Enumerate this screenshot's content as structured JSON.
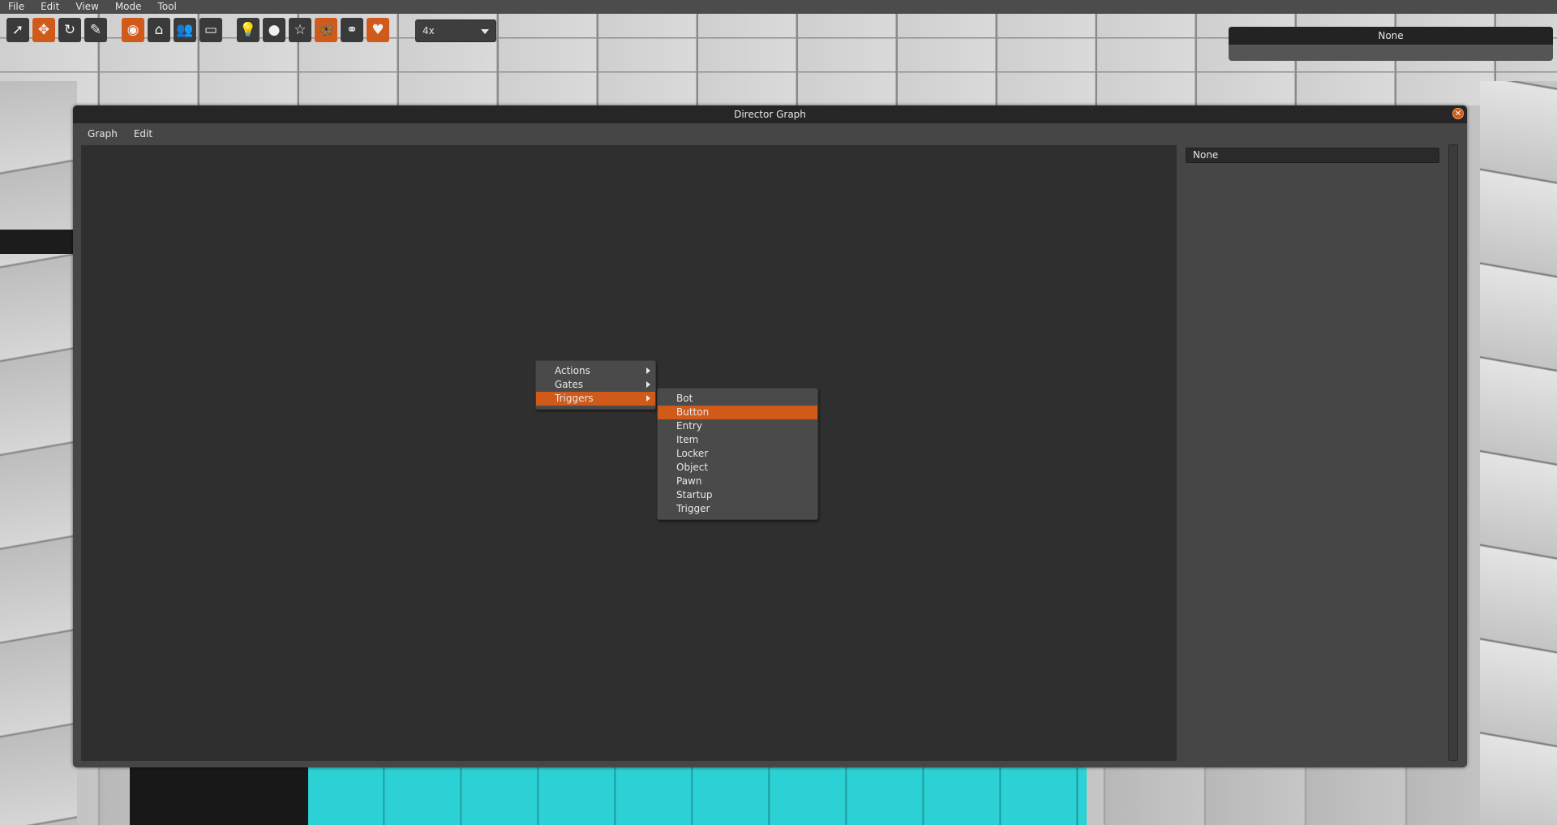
{
  "menubar": {
    "items": [
      "File",
      "Edit",
      "View",
      "Mode",
      "Tool"
    ]
  },
  "toolbar": {
    "tools": [
      {
        "icon": "select-arrow-icon",
        "glyph": "➚",
        "active": false
      },
      {
        "icon": "move-icon",
        "glyph": "✥",
        "active": true
      },
      {
        "icon": "rotate-icon",
        "glyph": "↻",
        "active": false
      },
      {
        "icon": "paint-brush-icon",
        "glyph": "✎",
        "active": false
      },
      {
        "icon": "globe-icon",
        "glyph": "◉",
        "active": true
      },
      {
        "icon": "home-icon",
        "glyph": "⌂",
        "active": false
      },
      {
        "icon": "users-icon",
        "glyph": "👥",
        "active": false
      },
      {
        "icon": "monitor-icon",
        "glyph": "▭",
        "active": false
      },
      {
        "icon": "lightbulb-icon",
        "glyph": "💡",
        "active": false
      },
      {
        "icon": "sphere-icon",
        "glyph": "●",
        "active": false
      },
      {
        "icon": "star-icon",
        "glyph": "☆",
        "active": false
      },
      {
        "icon": "butterfly-icon",
        "glyph": "🦋",
        "active": true
      },
      {
        "icon": "balloons-icon",
        "glyph": "⚭",
        "active": false
      },
      {
        "icon": "heart-icon",
        "glyph": "♥",
        "active": true
      }
    ],
    "zoom": {
      "value": "4x"
    }
  },
  "top_right_panel": {
    "title": "None"
  },
  "window": {
    "title": "Director Graph",
    "menu": [
      "Graph",
      "Edit"
    ],
    "side_field": "None"
  },
  "context_menu": {
    "items": [
      "Actions",
      "Gates",
      "Triggers"
    ],
    "highlighted": "Triggers"
  },
  "submenu": {
    "items": [
      "Bot",
      "Button",
      "Entry",
      "Item",
      "Locker",
      "Object",
      "Pawn",
      "Startup",
      "Trigger"
    ],
    "highlighted": "Button"
  },
  "colors": {
    "accent": "#d05a19",
    "panel": "#464646",
    "canvas": "#2f2f2f"
  }
}
